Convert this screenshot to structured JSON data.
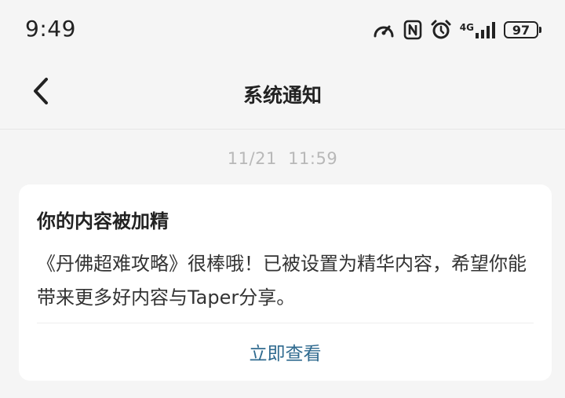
{
  "status_bar": {
    "time": "9:49",
    "network": "4G",
    "battery_level": "97",
    "icons": [
      "speedometer-icon",
      "nfc-icon",
      "alarm-icon",
      "signal-icon",
      "battery-icon"
    ]
  },
  "nav": {
    "title": "系统通知",
    "back_icon": "chevron-left-icon"
  },
  "message": {
    "timestamp": "11/21  11:59",
    "title": "你的内容被加精",
    "body": "《丹佛超难攻略》很棒哦！已被设置为精华内容，希望你能带来更多好内容与Taper分享。",
    "action_label": "立即查看"
  },
  "colors": {
    "background": "#f5f5f5",
    "card": "#ffffff",
    "link": "#2f6a8f",
    "timestamp": "#b8b8b8"
  }
}
